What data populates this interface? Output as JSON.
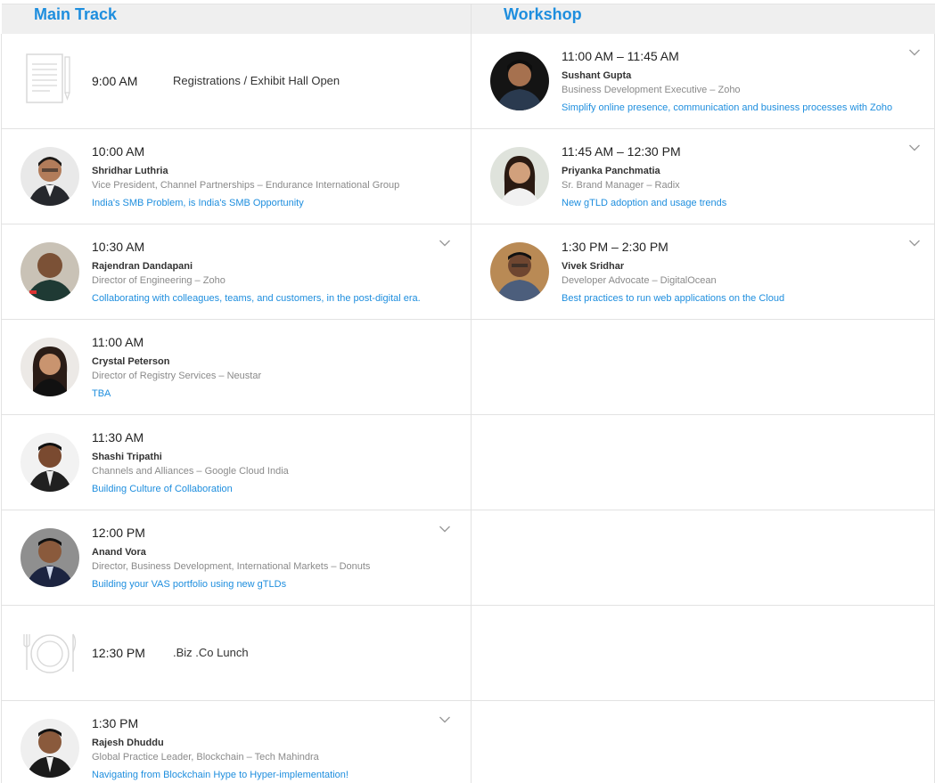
{
  "tracks": {
    "main": "Main Track",
    "workshop": "Workshop"
  },
  "main": {
    "registration": {
      "time": "9:00 AM",
      "label": "Registrations / Exhibit Hall Open",
      "icon": "document-icon"
    },
    "sessions": [
      {
        "time": "10:00 AM",
        "name": "Shridhar Luthria",
        "role": "Vice President, Channel Partnerships – Endurance International Group",
        "talk": "India's SMB Problem, is India's SMB Opportunity",
        "expand": false
      },
      {
        "time": "10:30 AM",
        "name": "Rajendran Dandapani",
        "role": "Director of Engineering – Zoho",
        "talk": "Collaborating with colleagues, teams, and customers, in the post-digital era.",
        "expand": true
      },
      {
        "time": "11:00 AM",
        "name": "Crystal Peterson",
        "role": "Director of Registry Services – Neustar",
        "talk": "TBA",
        "expand": false
      },
      {
        "time": "11:30 AM",
        "name": "Shashi Tripathi",
        "role": "Channels and Alliances – Google Cloud India",
        "talk": "Building Culture of Collaboration",
        "expand": false
      },
      {
        "time": "12:00 PM",
        "name": "Anand Vora",
        "role": "Director, Business Development, International Markets – Donuts",
        "talk": "Building your VAS portfolio using new gTLDs",
        "expand": true
      }
    ],
    "lunch": {
      "time": "12:30 PM",
      "label": ".Biz .Co Lunch",
      "icon": "plate-cutlery-icon"
    },
    "last": {
      "time": "1:30 PM",
      "name": "Rajesh Dhuddu",
      "role": "Global Practice Leader, Blockchain – Tech Mahindra",
      "talk": "Navigating from Blockchain Hype to Hyper-implementation!",
      "expand": true
    }
  },
  "workshop": {
    "sessions": [
      {
        "time": "11:00 AM – 11:45 AM",
        "name": "Sushant Gupta",
        "role": "Business Development Executive – Zoho",
        "talk": "Simplify online presence, communication and business processes with Zoho",
        "expand": true
      },
      {
        "time": "11:45 AM – 12:30 PM",
        "name": "Priyanka Panchmatia",
        "role": "Sr. Brand Manager – Radix",
        "talk": "New gTLD adoption and usage trends",
        "expand": true
      },
      {
        "time": "1:30 PM – 2:30 PM",
        "name": "Vivek Sridhar",
        "role": "Developer Advocate – DigitalOcean",
        "talk": "Best practices to run web applications on the Cloud",
        "expand": true
      }
    ]
  },
  "colors": {
    "accent": "#1e8ede",
    "header_bg": "#efefef",
    "muted": "#8a8a8a"
  }
}
